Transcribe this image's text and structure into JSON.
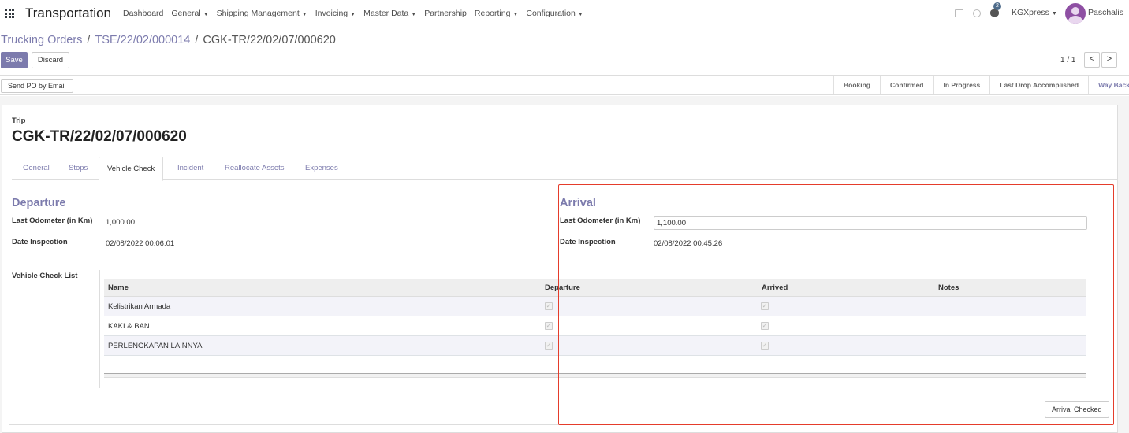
{
  "navbar": {
    "app_title": "Transportation",
    "menu": [
      "Dashboard",
      "General",
      "Shipping Management",
      "Invoicing",
      "Master Data",
      "Partnership",
      "Reporting",
      "Configuration"
    ],
    "menu_has_caret": [
      false,
      true,
      true,
      true,
      true,
      false,
      true,
      true
    ],
    "notification_count": "2",
    "company": "KGXpress",
    "user": "Paschalis"
  },
  "breadcrumb": {
    "root": "Trucking Orders",
    "parent": "TSE/22/02/000014",
    "current": "CGK-TR/22/02/07/000620",
    "separator": "/"
  },
  "actions": {
    "save": "Save",
    "discard": "Discard",
    "pager": "1 / 1",
    "prev": "<",
    "next": ">"
  },
  "status_bar": {
    "send_po": "Send PO by Email",
    "stages": [
      "Booking",
      "Confirmed",
      "In Progress",
      "Last Drop Accomplished",
      "Way Back"
    ],
    "active_stage": "Way Back"
  },
  "form": {
    "trip_label": "Trip",
    "trip_name": "CGK-TR/22/02/07/000620",
    "tabs": [
      "General",
      "Stops",
      "Vehicle Check",
      "Incident",
      "Reallocate Assets",
      "Expenses"
    ],
    "active_tab": "Vehicle Check",
    "departure": {
      "title": "Departure",
      "odometer_label": "Last Odometer (in Km)",
      "odometer_value": "1,000.00",
      "date_label": "Date Inspection",
      "date_value": "02/08/2022 00:06:01"
    },
    "arrival": {
      "title": "Arrival",
      "odometer_label": "Last Odometer (in Km)",
      "odometer_value": "1,100.00",
      "date_label": "Date Inspection",
      "date_value": "02/08/2022 00:45:26"
    },
    "checklist_label": "Vehicle Check List",
    "table": {
      "columns": [
        "Name",
        "Departure",
        "Arrived",
        "Notes"
      ],
      "rows": [
        {
          "name": "Kelistrikan Armada",
          "departure": true,
          "arrived": true,
          "notes": ""
        },
        {
          "name": "KAKI & BAN",
          "departure": true,
          "arrived": true,
          "notes": ""
        },
        {
          "name": "PERLENGKAPAN LAINNYA",
          "departure": true,
          "arrived": true,
          "notes": ""
        }
      ]
    },
    "arrival_checked_button": "Arrival Checked"
  },
  "colors": {
    "accent": "#7c7bad",
    "highlight": "#e53c2b"
  }
}
